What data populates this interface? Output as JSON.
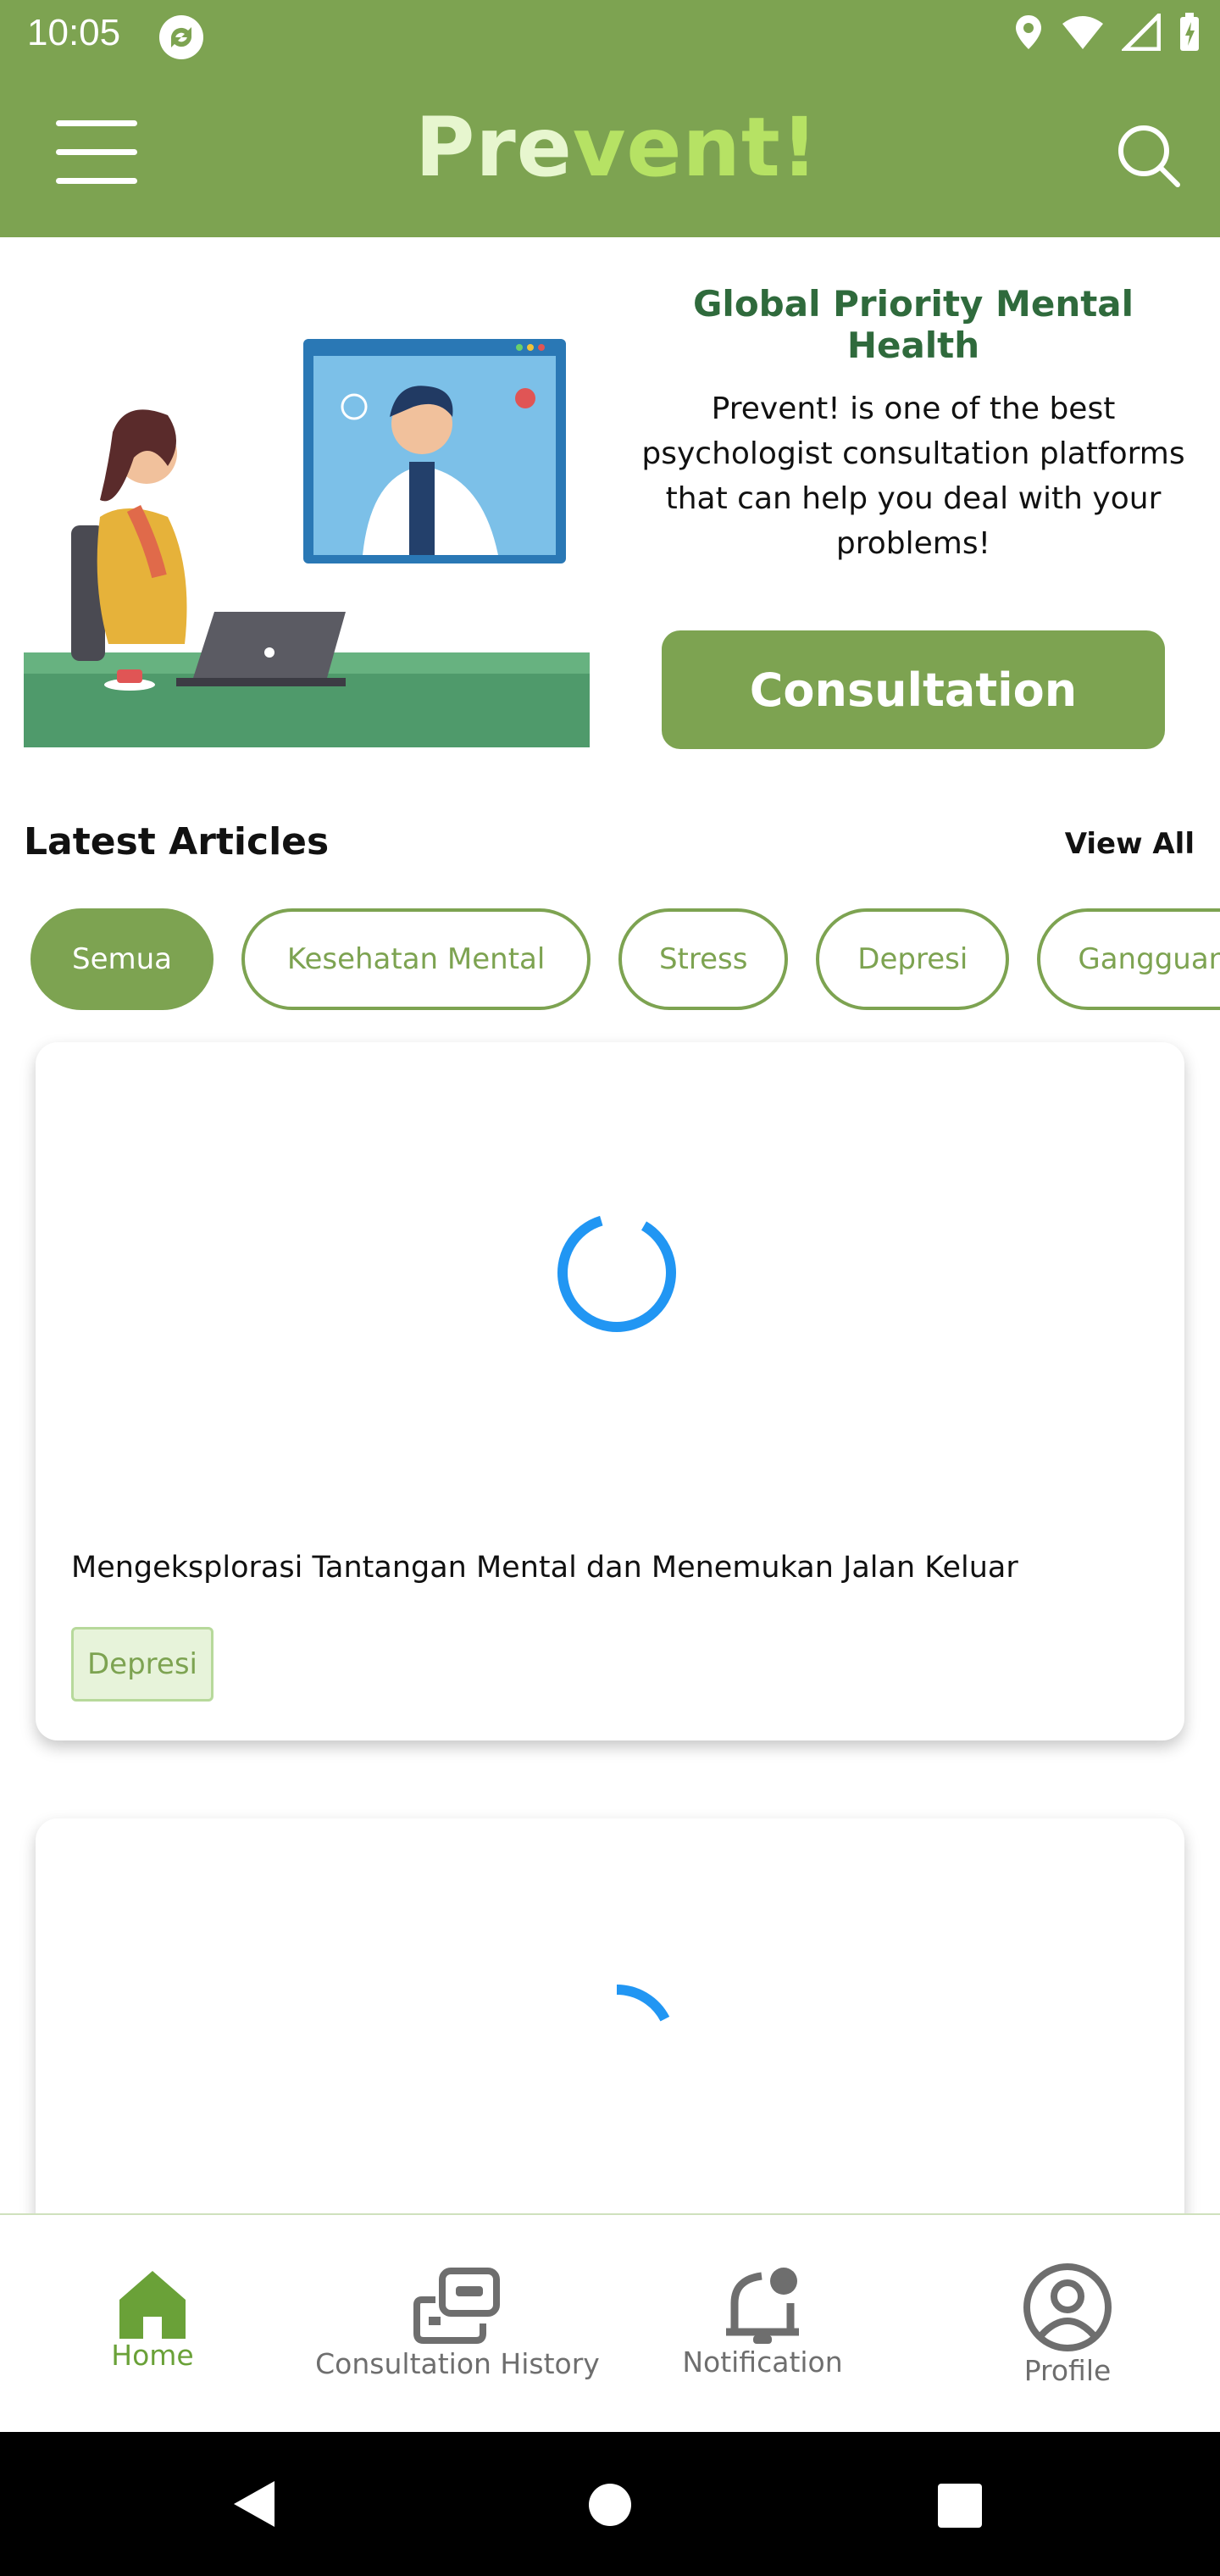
{
  "status_bar": {
    "time": "10:05"
  },
  "app_bar": {
    "brand_part1": "Pre",
    "brand_part2": "vent!"
  },
  "hero": {
    "title": "Global Priority Mental Health",
    "description": "Prevent! is one of the best psychologist consultation platforms that can help you deal with your problems!",
    "button_label": "Consultation"
  },
  "articles": {
    "section_title": "Latest Articles",
    "view_all_label": "View All",
    "chips": [
      "Semua",
      "Kesehatan Mental",
      "Stress",
      "Depresi",
      "Gangguan"
    ],
    "active_chip": "Semua",
    "items": [
      {
        "title": "Mengeksplorasi Tantangan Mental dan Menemukan Jalan Keluar",
        "tag": "Depresi"
      }
    ]
  },
  "bottom_nav": {
    "items": [
      {
        "label": "Home",
        "icon": "home-icon",
        "active": true
      },
      {
        "label": "Consultation History",
        "icon": "consultation-history-icon",
        "active": false
      },
      {
        "label": "Notification",
        "icon": "notification-icon",
        "active": false
      },
      {
        "label": "Profile",
        "icon": "profile-icon",
        "active": false
      }
    ]
  },
  "colors": {
    "primary": "#7da351",
    "title_green": "#2f6a3c",
    "spinner": "#2196f3"
  }
}
